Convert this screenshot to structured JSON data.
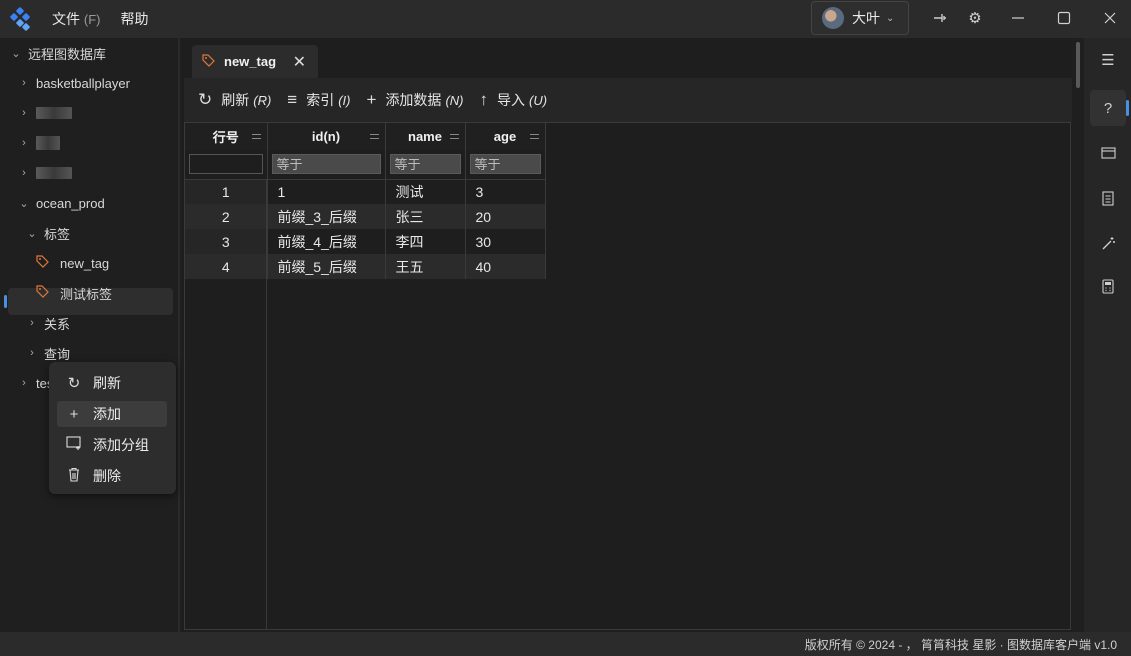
{
  "titlebar": {
    "menus": [
      {
        "label": "文件",
        "hint": "(F)"
      },
      {
        "label": "帮助",
        "hint": ""
      }
    ],
    "user_name": "大叶"
  },
  "tree": {
    "root": "远程图数据库",
    "items": [
      "basketballplayer",
      "ocean_prod",
      "标签",
      "new_tag",
      "测试标签",
      "关系",
      "查询",
      "tes"
    ]
  },
  "tab": {
    "label": "new_tag"
  },
  "toolbar": {
    "refresh": {
      "label": "刷新",
      "key": "(R)"
    },
    "index": {
      "label": "索引",
      "key": "(I)"
    },
    "add_data": {
      "label": "添加数据",
      "key": "(N)"
    },
    "import": {
      "label": "导入",
      "key": "(U)"
    }
  },
  "grid": {
    "columns": [
      "行号",
      "id(n)",
      "name",
      "age"
    ],
    "filter_placeholder": "等于",
    "rows": [
      {
        "rn": "1",
        "id": "1",
        "name": "测试",
        "age": "3"
      },
      {
        "rn": "2",
        "id": "前缀_3_后缀",
        "name": "张三",
        "age": "20"
      },
      {
        "rn": "3",
        "id": "前缀_4_后缀",
        "name": "李四",
        "age": "30"
      },
      {
        "rn": "4",
        "id": "前缀_5_后缀",
        "name": "王五",
        "age": "40"
      }
    ]
  },
  "context_menu": {
    "items": [
      "刷新",
      "添加",
      "添加分组",
      "删除"
    ]
  },
  "status": {
    "text": "版权所有 © 2024 - ， 筲筲科技  星影 · 图数据库客户端  v1.0"
  },
  "colors": {
    "accent": "#4a90e2",
    "tag_icon": "#e0773d"
  }
}
